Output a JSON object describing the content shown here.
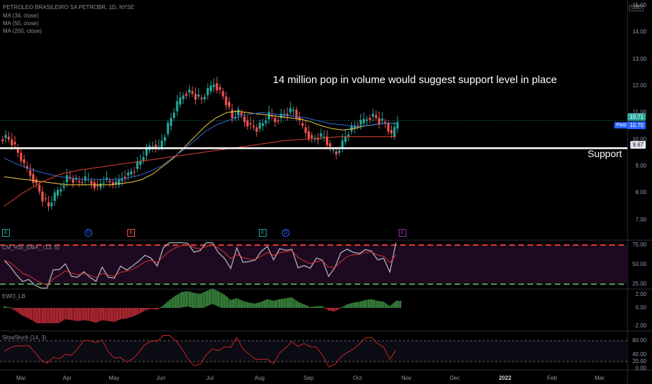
{
  "header": {
    "symbol": "PETROLEO BRASILEIRO SA PETROBR, 1D, NYSE",
    "ma34": "MA (34, close)",
    "ma50": "MA (50, close)",
    "ma200": "MA (200, close)",
    "currency": "USD"
  },
  "annotation": "14 million pop in volume would suggest support level in place",
  "support_label": "Support",
  "panes": {
    "rsi_label": "CM_RSI_EMA_ (13, 5)",
    "ewo_label": "EWO_LB",
    "stoch_label": "SlowStoch (14, 3)"
  },
  "price_tags": {
    "last": "10.71",
    "post_label": "Post",
    "post": "10.70",
    "support": "9.67"
  },
  "events": [
    {
      "letter": "E",
      "color": "#26a69a",
      "circle": false
    },
    {
      "letter": "D",
      "color": "#2962ff",
      "circle": true
    },
    {
      "letter": "E",
      "color": "#ef5350",
      "circle": false
    },
    {
      "letter": "E",
      "color": "#26a69a",
      "circle": false
    },
    {
      "letter": "D",
      "color": "#2962ff",
      "circle": true
    },
    {
      "letter": "E",
      "color": "#9c27b0",
      "circle": false
    }
  ],
  "colors": {
    "up": "#26a69a",
    "down": "#ef5350",
    "ma34": "#f5d142",
    "ma50": "#2e6fd6",
    "ma200": "#e0452f",
    "support_line": "#ffffff",
    "rsi_band": "#1e0a20",
    "ewo_up": "#4caf50",
    "ewo_down": "#f23645",
    "stoch": "#e0281e"
  },
  "chart_data": {
    "type": "candlestick",
    "title": "PETROLEO BRASILEIRO SA PETROBR, 1D, NYSE",
    "x_ticks": [
      "Mar",
      "Apr",
      "May",
      "Jun",
      "Jul",
      "Aug",
      "Sep",
      "Oct",
      "Nov",
      "Dec",
      "2022",
      "Feb",
      "Mar"
    ],
    "y_ticks": [
      "15.00",
      "14.00",
      "13.00",
      "12.00",
      "11.00",
      "10.00",
      "9.00",
      "8.00",
      "7.00"
    ],
    "ylim": [
      6.6,
      15.1
    ],
    "support_level": 9.67,
    "close_series": [
      10.1,
      9.9,
      9.5,
      9.0,
      8.7,
      8.3,
      7.8,
      7.5,
      7.9,
      8.2,
      8.6,
      8.5,
      8.4,
      8.5,
      8.4,
      8.2,
      8.5,
      8.4,
      8.3,
      8.6,
      8.7,
      8.9,
      9.2,
      9.6,
      9.8,
      9.7,
      10.2,
      10.8,
      11.3,
      11.7,
      11.8,
      11.6,
      11.5,
      11.8,
      12.1,
      11.8,
      11.4,
      10.8,
      11.0,
      10.7,
      10.5,
      10.4,
      10.6,
      10.9,
      10.7,
      10.9,
      11.0,
      11.1,
      10.6,
      10.3,
      10.0,
      10.1,
      10.1,
      9.6,
      9.5,
      9.9,
      10.3,
      10.5,
      10.6,
      10.8,
      10.9,
      10.7,
      10.6,
      10.1,
      10.71
    ],
    "ma34": [
      8.6,
      8.55,
      8.5,
      8.45,
      8.4,
      8.35,
      8.3,
      8.3,
      8.3,
      8.3,
      8.3,
      8.35,
      8.4,
      8.5,
      8.7,
      9.0,
      9.3,
      9.7,
      10.1,
      10.5,
      10.8,
      11.0,
      11.05,
      11.0,
      10.95,
      10.9,
      10.85,
      10.8,
      10.75,
      10.65,
      10.5,
      10.4,
      10.35,
      10.4,
      10.5,
      10.55,
      10.6,
      10.6
    ],
    "ma50": [
      9.3,
      9.1,
      8.95,
      8.8,
      8.7,
      8.6,
      8.55,
      8.5,
      8.5,
      8.5,
      8.5,
      8.55,
      8.65,
      8.8,
      9.0,
      9.3,
      9.6,
      9.95,
      10.3,
      10.55,
      10.7,
      10.85,
      10.95,
      11.0,
      10.95,
      10.9,
      10.85,
      10.8,
      10.7,
      10.6,
      10.55,
      10.5,
      10.5,
      10.55,
      10.6,
      10.6
    ],
    "ma200": [
      7.5,
      8.0,
      8.4,
      8.7,
      8.85,
      8.95,
      9.05,
      9.15,
      9.25,
      9.35,
      9.45,
      9.55,
      9.65,
      9.75,
      9.85,
      9.95,
      10.0,
      10.05,
      10.1,
      10.1,
      10.1,
      10.1
    ],
    "rsi": {
      "levels": [
        "75.00",
        "50.00",
        "25.00"
      ],
      "ylim": [
        15,
        85
      ]
    },
    "ewo": {
      "levels": [
        "2.00",
        "0.00",
        "-2.00"
      ]
    },
    "stoch": {
      "levels": [
        "80.00",
        "40.00",
        "20.00",
        "0.00"
      ]
    }
  }
}
